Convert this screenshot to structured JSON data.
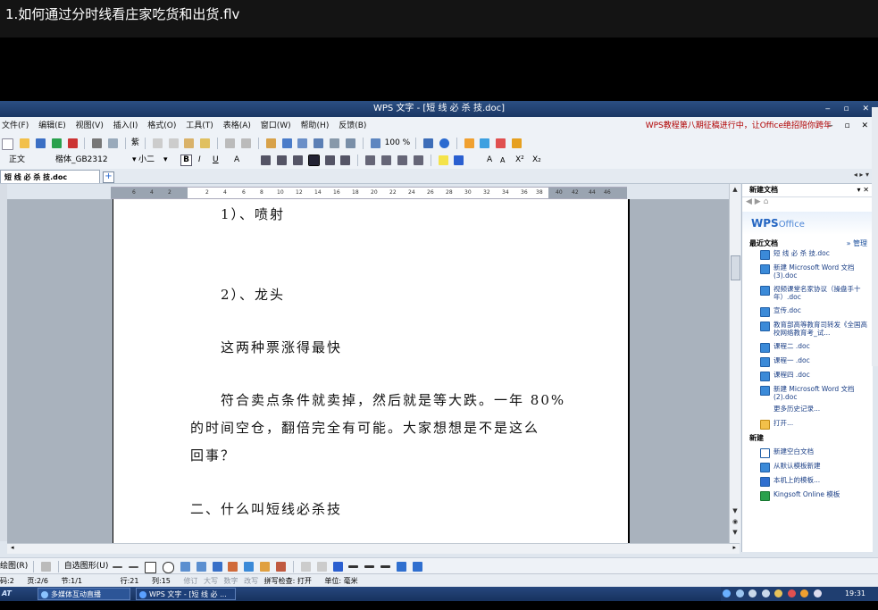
{
  "video": {
    "title": "1.如何通过分时线看庄家吃货和出货.flv"
  },
  "window": {
    "title": "WPS 文字 - [短 线 必 杀 技.doc]",
    "controls": "‒ ▫ ✕"
  },
  "menubar": {
    "items": [
      "文件(F)",
      "编辑(E)",
      "视图(V)",
      "插入(I)",
      "格式(O)",
      "工具(T)",
      "表格(A)",
      "窗口(W)",
      "帮助(H)",
      "反馈(B)"
    ],
    "notice": "WPS教程第八期征稿进行中，让Office绝招陪你跨年",
    "controls": "‒ ▫ ✕"
  },
  "toolbar": {
    "style_label": "紫",
    "zoom": "100 %"
  },
  "format_toolbar": {
    "style": "正文",
    "font": "楷体_GB2312",
    "size": "小二",
    "bold": "B",
    "italic": "I",
    "underline": "U",
    "text_a": "A",
    "superscript": "X²",
    "subscript": "X₂"
  },
  "tabs": {
    "doc": "短 线 必 杀 技.doc",
    "add": "+"
  },
  "ruler": {
    "ticks": [
      "6",
      "4",
      "2",
      "2",
      "4",
      "6",
      "8",
      "10",
      "12",
      "14",
      "16",
      "18",
      "20",
      "22",
      "24",
      "26",
      "28",
      "30",
      "32",
      "34",
      "36",
      "38",
      "40",
      "42",
      "44",
      "46"
    ]
  },
  "document": {
    "lines": [
      "1）、喷射",
      "2）、龙头",
      "这两种票涨得最快",
      "符合卖点条件就卖掉，然后就是等大跌。一年 80%",
      "的时间空仓，翻倍完全有可能。大家想想是不是这么",
      "回事？",
      "二、什么叫短线必杀技"
    ]
  },
  "taskpane": {
    "title": "新建文档",
    "logo": "WPS",
    "logo_sub": "Office",
    "recent_title": "最近文档",
    "manage": "» 管理",
    "recent": [
      "短 线 必 杀 技.doc",
      "新建 Microsoft Word 文档 (3).doc",
      "视频课堂名家协议（操盘手十年）.doc",
      "宣传.doc",
      "教育部高等教育司转发《全国高校网络教育考_试...",
      "课程二 .doc",
      "课程一 .doc",
      "课程四 .doc",
      "新建 Microsoft Word 文档 (2).doc"
    ],
    "history": "更多历史记录...",
    "open": "打开...",
    "new_title": "新建",
    "new_items": [
      "新建空白文档",
      "从默认模板新建",
      "本机上的模板...",
      "Kingsoft Online 模板"
    ]
  },
  "drawbar": {
    "draw": "绘图(R)",
    "autoshape": "自选图形(U)"
  },
  "statusbar": {
    "page_no": "码:2",
    "page": "页:2/6",
    "section": "节:1/1",
    "row": "行:21",
    "col": "列:15",
    "modes": [
      "修订",
      "大写",
      "数字",
      "改写"
    ],
    "spell": "拼写检查: 打开",
    "unit": "单位: 毫米"
  },
  "taskbar": {
    "logo": "AT",
    "tasks": [
      "多媒体互动直播",
      "WPS 文字 - [短 线 必 ..."
    ],
    "clock": "19:31"
  }
}
